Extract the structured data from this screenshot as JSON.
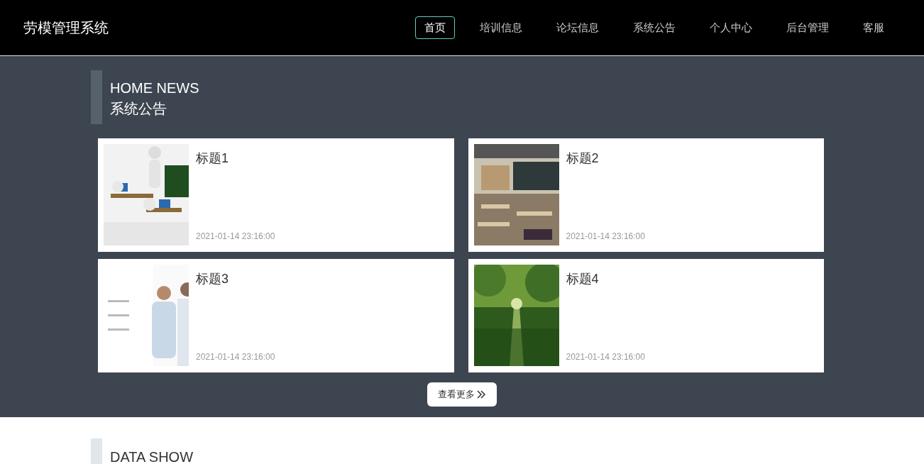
{
  "header": {
    "logo": "劳模管理系统",
    "nav": [
      {
        "label": "首页",
        "selected": true
      },
      {
        "label": "培训信息",
        "selected": false
      },
      {
        "label": "论坛信息",
        "selected": false
      },
      {
        "label": "系统公告",
        "selected": false
      },
      {
        "label": "个人中心",
        "selected": false
      },
      {
        "label": "后台管理",
        "selected": false
      },
      {
        "label": "客服",
        "selected": false
      }
    ]
  },
  "news": {
    "title_en": "HOME NEWS",
    "title_cn": "系统公告",
    "items": [
      {
        "title": "标题1",
        "time": "2021-01-14 23:16:00",
        "kind": "picture"
      },
      {
        "title": "标题2",
        "time": "2021-01-14 23:16:00",
        "kind": "picture"
      },
      {
        "title": "标题3",
        "time": "2021-01-14 23:16:00",
        "kind": "picture"
      },
      {
        "title": "标题4",
        "time": "2021-01-14 23:16:00",
        "kind": "picture"
      }
    ],
    "more_button": "查看更多"
  },
  "data_show": {
    "title_en": "DATA SHOW"
  }
}
